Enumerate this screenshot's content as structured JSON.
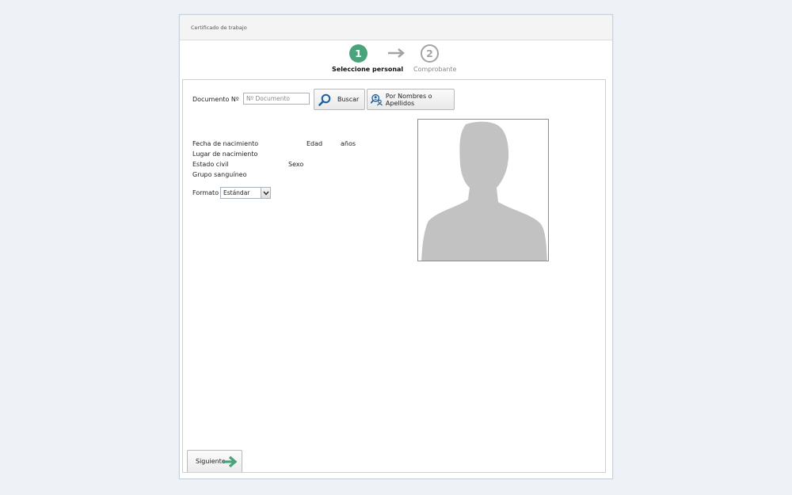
{
  "window": {
    "title": "Certificado de trabajo"
  },
  "stepper": {
    "steps": [
      {
        "number": "1",
        "label": "Seleccione personal",
        "active": true
      },
      {
        "number": "2",
        "label": "Comprobante",
        "active": false
      }
    ]
  },
  "search": {
    "document_label": "Documento Nº",
    "document_placeholder": "Nº Documento",
    "document_value": "",
    "search_button": "Buscar",
    "name_search_button": "Por Nombres o Apellidos"
  },
  "person": {
    "birth_date_label": "Fecha de nacimiento",
    "age_label": "Edad",
    "age_unit": "años",
    "birth_place_label": "Lugar de nacimiento",
    "civil_status_label": "Estado civil",
    "sex_label": "Sexo",
    "blood_group_label": "Grupo sanguíneo"
  },
  "format": {
    "label": "Formato",
    "selected": "Estándar"
  },
  "footer": {
    "next_button": "Siguiente"
  },
  "colors": {
    "accent_green": "#4aa37a",
    "inactive_gray": "#a3a3a3",
    "search_icon_blue": "#1f5f9e",
    "silhouette": "#c2c2c2"
  },
  "icons": {
    "search": "magnifier-icon",
    "people_search": "user-search-icon",
    "next": "arrow-right-icon",
    "photo": "person-silhouette-icon"
  }
}
